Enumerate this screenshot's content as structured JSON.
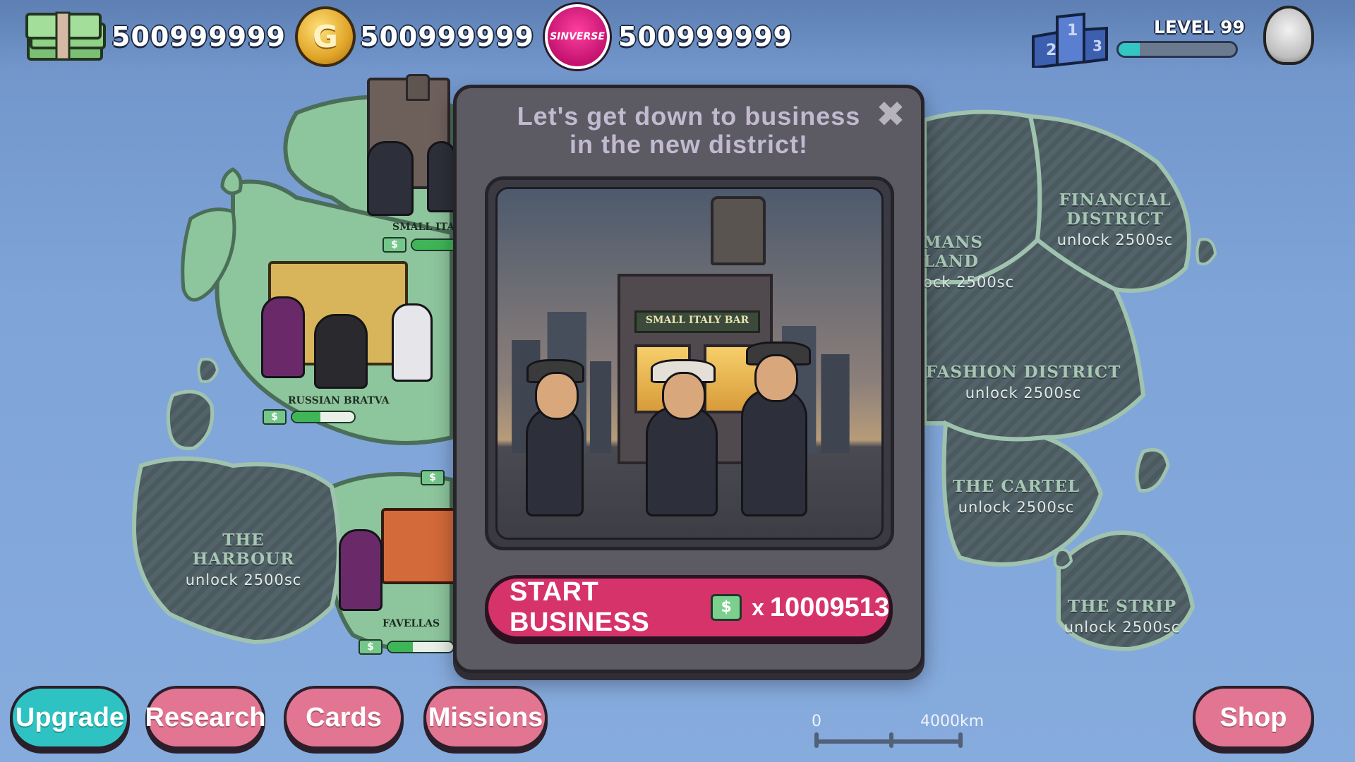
{
  "hud": {
    "cash": "500999999",
    "gold": "500999999",
    "sin": "500999999",
    "sin_logo_text": "SINVERSE",
    "level_label": "LEVEL 99",
    "level_progress": 0.18
  },
  "map": {
    "districts": [
      {
        "name": "FINANCIAL\nDISTRICT",
        "unlock": "unlock 2500sc"
      },
      {
        "name": "MANS LAND",
        "unlock": "ock 2500sc"
      },
      {
        "name": "FASHION DISTRICT",
        "unlock": "unlock 2500sc"
      },
      {
        "name": "THE CARTEL",
        "unlock": "unlock 2500sc"
      },
      {
        "name": "THE STRIP",
        "unlock": "unlock 2500sc"
      },
      {
        "name": "THE HARBOUR",
        "unlock": "unlock 2500sc"
      }
    ],
    "businesses": [
      {
        "name": "SMALL ITAL",
        "progress": 0.62
      },
      {
        "name": "RUSSIAN BRATVA",
        "progress": 0.45
      },
      {
        "name": "FAVELLAS",
        "progress": 0.38
      }
    ]
  },
  "modal": {
    "title_line1": "Let's get down to business",
    "title_line2": "in the new district!",
    "close_glyph": "✖",
    "art_sign": "SMALL ITALY BAR",
    "start_label": "START BUSINESS",
    "cost_prefix": "x",
    "cost": "10009513"
  },
  "nav": {
    "upgrade": "Upgrade",
    "research": "Research",
    "cards": "Cards",
    "missions": "Missions",
    "shop": "Shop"
  },
  "scale": {
    "start": "0",
    "end": "4000km"
  },
  "colors": {
    "accent_pink": "#d6336b",
    "nav_pink": "#e27592",
    "nav_teal": "#2ec3c2",
    "map_green": "#8dc59c",
    "map_locked": "#4a5a5f"
  }
}
